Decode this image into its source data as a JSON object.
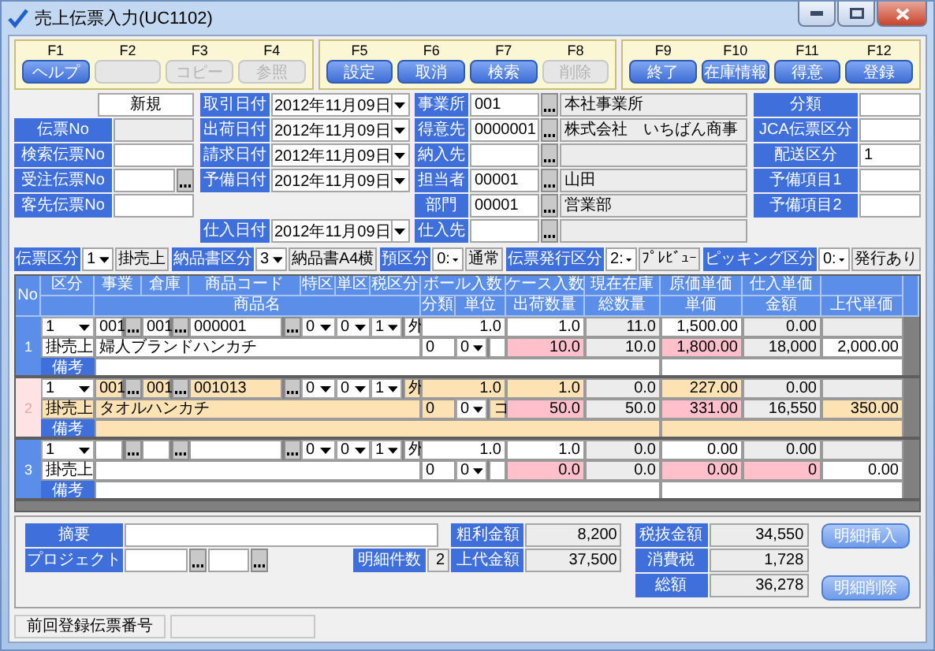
{
  "window": {
    "title": "売上伝票入力(UC1102)"
  },
  "function_key_groups": [
    {
      "keys": [
        {
          "key": "F1",
          "label": "ヘルプ",
          "disabled": false
        },
        {
          "key": "F2",
          "disabled": true
        },
        {
          "key": "F3",
          "label": "コピー",
          "disabled": true
        },
        {
          "key": "F4",
          "label": "参照",
          "disabled": true
        }
      ]
    },
    {
      "keys": [
        {
          "key": "F5",
          "label": "設定",
          "disabled": false
        },
        {
          "key": "F6",
          "label": "取消",
          "disabled": false
        },
        {
          "key": "F7",
          "label": "検索",
          "disabled": false
        },
        {
          "key": "F8",
          "label": "削除",
          "disabled": true
        }
      ]
    },
    {
      "keys": [
        {
          "key": "F9",
          "label": "終了",
          "disabled": false
        },
        {
          "key": "F10",
          "label": "在庫情報",
          "disabled": false
        },
        {
          "key": "F11",
          "label": "得意",
          "disabled": false
        },
        {
          "key": "F12",
          "label": "登録",
          "disabled": false
        }
      ]
    }
  ],
  "header": {
    "slip_fields": [
      {
        "kind": "status",
        "value": "新規"
      },
      {
        "kind": "readonly",
        "label": "伝票No"
      },
      {
        "kind": "text",
        "label": "検索伝票No"
      },
      {
        "kind": "lookup",
        "label": "受注伝票No"
      },
      {
        "kind": "text",
        "label": "客先伝票No"
      }
    ],
    "dates": [
      {
        "label": "取引日付",
        "value": "2012年11月09日"
      },
      {
        "label": "出荷日付",
        "value": "2012年11月09日"
      },
      {
        "label": "請求日付",
        "value": "2012年11月09日"
      },
      {
        "label": "予備日付",
        "value": "2012年11月09日"
      }
    ],
    "purchase_date": {
      "label": "仕入日付",
      "value": "2012年11月09日"
    },
    "parties": [
      {
        "label": "事業所",
        "code": "001",
        "name": "本社事業所"
      },
      {
        "label": "得意先",
        "code": "0000001",
        "name": "株式会社　いちばん商事"
      },
      {
        "label": "納入先"
      },
      {
        "label": "担当者",
        "code": "00001",
        "name": "山田"
      },
      {
        "label": "部門",
        "code": "00001",
        "name": "営業部"
      },
      {
        "label": "仕入先"
      }
    ],
    "extra_fields": [
      {
        "label": "分類"
      },
      {
        "label": "JCA伝票区分"
      },
      {
        "label": "配送区分",
        "value": "1"
      },
      {
        "label": "予備項目1"
      },
      {
        "label": "予備項目2"
      }
    ],
    "selectors": [
      {
        "label": "伝票区分",
        "code": "1",
        "name": "掛売上"
      },
      {
        "label": "納品書区分",
        "code": "3",
        "name": "納品書A4横"
      },
      {
        "label": "預区分",
        "code": "0:",
        "name": "通常"
      },
      {
        "label": "伝票発行区分",
        "code": "2:",
        "name": "ﾌﾟﾚﾋﾞｭｰ"
      },
      {
        "label": "ピッキング区分",
        "code": "0:",
        "name": "発行あり"
      }
    ]
  },
  "grid": {
    "header_top": [
      "No",
      "区分",
      "事業",
      "倉庫",
      "商品コード",
      "特区",
      "単区",
      "税区分",
      "ボール入数",
      "ケース入数",
      "現在在庫",
      "原価単価",
      "仕入単価"
    ],
    "header_bottom": [
      "商品名",
      "分類",
      "単位",
      "出荷数量",
      "総数量",
      "単価",
      "金額",
      "上代単価"
    ],
    "records": [
      {
        "no": "1",
        "selected": false,
        "type": "1",
        "office": "001",
        "warehouse": "001",
        "code": "000001",
        "special": "0",
        "unit_class": "0",
        "tax_class": "1",
        "tax_label": "外",
        "ball_qty": "1.0",
        "case_qty": "1.0",
        "stock": "11.0",
        "cost": "1,500.00",
        "purchase_price": "0.00",
        "type_name": "掛売上",
        "product_name": "婦人ブランドハンカチ",
        "category": "0",
        "unit": "0",
        "ship_qty": "10.0",
        "total_qty": "10.0",
        "unit_price": "1,800.00",
        "amount": "18,000",
        "amount_alert": false,
        "list_price": "2,000.00",
        "note_label": "備考"
      },
      {
        "no": "2",
        "selected": true,
        "type": "1",
        "office": "001",
        "warehouse": "001",
        "code": "001013",
        "special": "0",
        "unit_class": "0",
        "tax_class": "1",
        "tax_label": "外",
        "ball_qty": "1.0",
        "case_qty": "1.0",
        "stock": "0.0",
        "cost": "227.00",
        "purchase_price": "0.00",
        "type_name": "掛売上",
        "product_name": "タオルハンカチ",
        "category": "0",
        "unit": "0",
        "unit_suffix": "コ",
        "ship_qty": "50.0",
        "total_qty": "50.0",
        "unit_price": "331.00",
        "amount": "16,550",
        "amount_alert": false,
        "list_price": "350.00",
        "note_label": "備考"
      },
      {
        "no": "3",
        "selected": false,
        "type": "1",
        "special": "0",
        "unit_class": "0",
        "tax_class": "1",
        "tax_label": "外",
        "ball_qty": "1.0",
        "case_qty": "1.0",
        "stock": "0.0",
        "cost": "0.00",
        "purchase_price": "0.00",
        "type_name": "掛売上",
        "category": "0",
        "unit": "0",
        "ship_qty": "0.0",
        "total_qty": "0.0",
        "unit_price": "0.00",
        "amount": "0",
        "amount_alert": true,
        "list_price": "0.00",
        "note_label": "備考"
      }
    ]
  },
  "summary": {
    "memo_label": "摘要",
    "project_label": "プロジェクト",
    "count_label": "明細件数",
    "count": "2",
    "profit": [
      {
        "label": "粗利金額",
        "value": "8,200"
      },
      {
        "label": "上代金額",
        "value": "37,500"
      }
    ],
    "tax": [
      {
        "label": "税抜金額",
        "value": "34,550"
      },
      {
        "label": "消費税",
        "value": "1,728"
      },
      {
        "label": "総額",
        "value": "36,278"
      }
    ],
    "buttons": [
      "明細挿入",
      "明細削除"
    ]
  },
  "status_bar": {
    "label": "前回登録伝票番号"
  }
}
